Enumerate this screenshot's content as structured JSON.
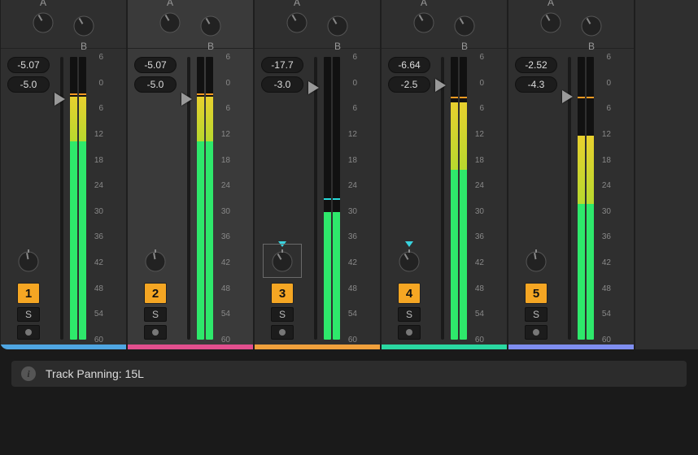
{
  "ab_labels": {
    "a": "A",
    "b": "B"
  },
  "scale_ticks": [
    6,
    0,
    6,
    12,
    18,
    24,
    30,
    36,
    42,
    48,
    54,
    60
  ],
  "tracks": [
    {
      "number": "1",
      "peak": "-5.07",
      "gain": "-5.0",
      "solo": "S",
      "color": "#4fa6e2",
      "selected": false,
      "fader_pct": 15,
      "pan_editing": false,
      "meter": {
        "green_top_pct": 30,
        "yellow_top_pct": 14,
        "orange_pct": 13,
        "aqua_pct": null
      }
    },
    {
      "number": "2",
      "peak": "-5.07",
      "gain": "-5.0",
      "solo": "S",
      "color": "#e24f8e",
      "selected": true,
      "fader_pct": 15,
      "pan_editing": false,
      "meter": {
        "green_top_pct": 30,
        "yellow_top_pct": 14,
        "orange_pct": 13,
        "aqua_pct": null
      }
    },
    {
      "number": "3",
      "peak": "-17.7",
      "gain": "-3.0",
      "solo": "S",
      "color": "#f0a03c",
      "selected": false,
      "fader_pct": 11,
      "pan_editing": true,
      "meter": {
        "green_top_pct": 55,
        "yellow_top_pct": null,
        "orange_pct": null,
        "aqua_pct": 50
      }
    },
    {
      "number": "4",
      "peak": "-6.64",
      "gain": "-2.5",
      "solo": "S",
      "color": "#2ad8a1",
      "selected": false,
      "fader_pct": 10,
      "pan_editing": true,
      "meter": {
        "green_top_pct": 40,
        "yellow_top_pct": 16,
        "orange_pct": 14,
        "aqua_pct": null
      }
    },
    {
      "number": "5",
      "peak": "-2.52",
      "gain": "-4.3",
      "solo": "S",
      "color": "#7f8ef0",
      "selected": false,
      "fader_pct": 14,
      "pan_editing": false,
      "meter": {
        "green_top_pct": 52,
        "yellow_top_pct": 28,
        "orange_pct": 14,
        "aqua_pct": null
      }
    }
  ],
  "status": {
    "label": "Track Panning:",
    "value": "15L"
  }
}
